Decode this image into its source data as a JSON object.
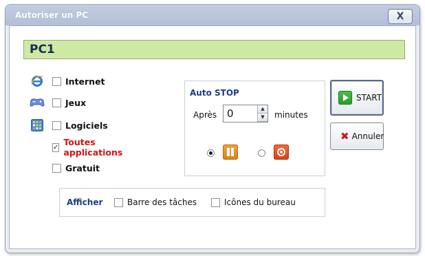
{
  "window": {
    "title": "Autoriser un PC",
    "close_label": "X"
  },
  "pc": {
    "name": "PC1"
  },
  "options": {
    "internet": {
      "label": "Internet",
      "checked": false,
      "icon": "internet-explorer-icon"
    },
    "jeux": {
      "label": "Jeux",
      "checked": false,
      "icon": "gamepad-icon"
    },
    "logiciels": {
      "label": "Logiciels",
      "checked": false,
      "icon": "software-grid-icon"
    },
    "toutes": {
      "label": "Toutes applications",
      "checked": true,
      "check_mark": "✓",
      "color": "#d21414"
    },
    "gratuit": {
      "label": "Gratuit",
      "checked": false
    }
  },
  "autostop": {
    "title": "Auto STOP",
    "apres_label": "Après",
    "value": "0",
    "unit_label": "minutes",
    "mode_pause_selected": true,
    "mode_stop_selected": false
  },
  "buttons": {
    "start_label": "START",
    "cancel_label": "Annuler",
    "cancel_icon": "✖"
  },
  "afficher": {
    "title": "Afficher",
    "taskbar": {
      "label": "Barre des tâches",
      "checked": false
    },
    "desktop_icons": {
      "label": "Icônes du bureau",
      "checked": false
    }
  },
  "colors": {
    "header_band": "#cfe8a3",
    "accent_blue": "#1a3a8c"
  }
}
